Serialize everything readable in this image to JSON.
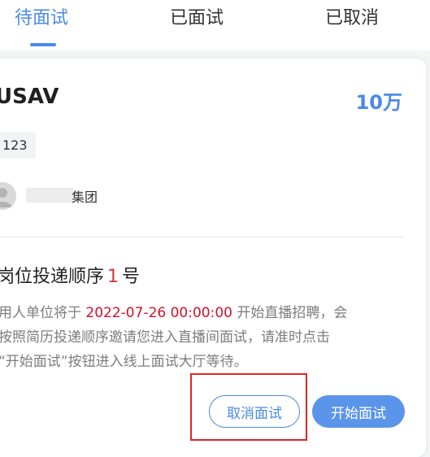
{
  "tabs": [
    {
      "label": "待面试",
      "active": true
    },
    {
      "label": "已面试",
      "active": false
    },
    {
      "label": "已取消",
      "active": false
    }
  ],
  "job": {
    "title": "USAV",
    "salary": "10万",
    "tag": "123",
    "company_name": "集团",
    "company_logo_icon": "company-avatar-icon"
  },
  "order": {
    "prefix": "岗位投递顺序",
    "number": "1",
    "suffix": "号"
  },
  "notice": {
    "line1_before": "用人单位将于",
    "datetime": "2022-07-26 00:00:00",
    "line1_after": "开始直播招聘，会",
    "line2": "按照简历投递顺序邀请您进入直播间面试，请准时点击",
    "line3": "“开始面试”按钮进入线上面试大厅等待。"
  },
  "actions": {
    "cancel_label": "取消面试",
    "start_label": "开始面试"
  },
  "colors": {
    "accent": "#4a8ae6",
    "date_red": "#d0112a",
    "order_red": "#d83a3a",
    "highlight_box": "#e02424"
  }
}
